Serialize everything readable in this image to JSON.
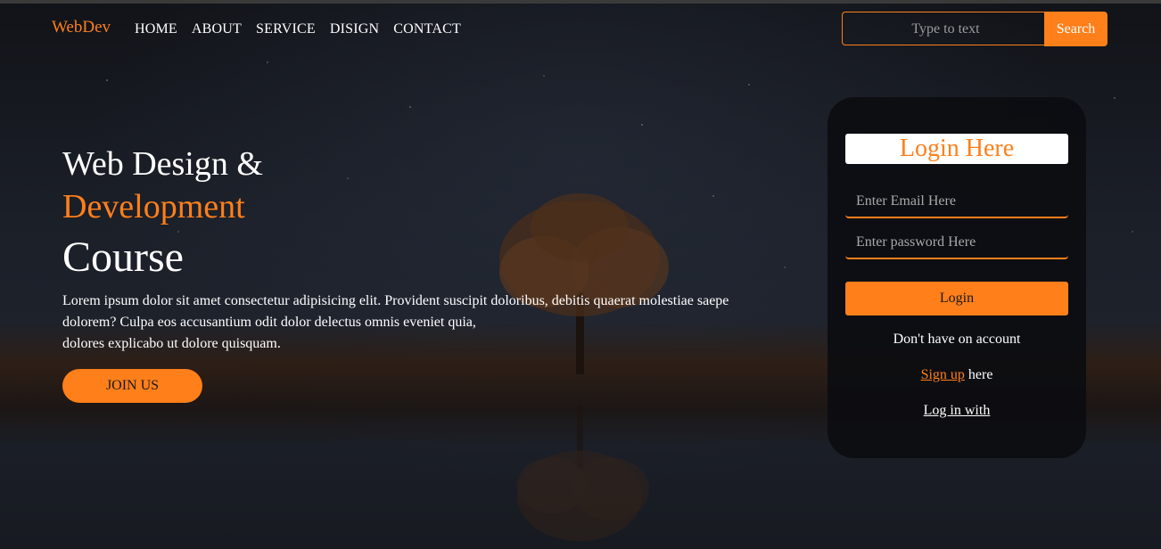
{
  "brand": {
    "logo": "WebDev"
  },
  "nav": {
    "items": [
      {
        "label": "HOME"
      },
      {
        "label": "ABOUT"
      },
      {
        "label": "SERVICE"
      },
      {
        "label": "DISIGN"
      },
      {
        "label": "CONTACT"
      }
    ]
  },
  "search": {
    "placeholder": "Type to text",
    "button_label": "Search"
  },
  "hero": {
    "line1": "Web Design &",
    "line2": "Development",
    "line3": "Course",
    "paragraph_line1": "Lorem ipsum dolor sit amet consectetur adipisicing elit. Provident suscipit doloribus, debitis quaerat molestiae saepe",
    "paragraph_line2": "dolorem? Culpa eos accusantium odit dolor delectus omnis eveniet quia,",
    "paragraph_line3": "dolores explicabo ut dolore quisquam.",
    "join_label": "JOIN US"
  },
  "login": {
    "title": "Login Here",
    "email_placeholder": "Enter Email Here",
    "password_placeholder": "Enter password Here",
    "button_label": "Login",
    "no_account_text": "Don't have on account",
    "signup_link": "Sign up",
    "signup_suffix": " here",
    "login_with": "Log in with"
  },
  "colors": {
    "accent": "#ff7f1a",
    "text": "#ffffff",
    "card": "#0c0d11"
  }
}
